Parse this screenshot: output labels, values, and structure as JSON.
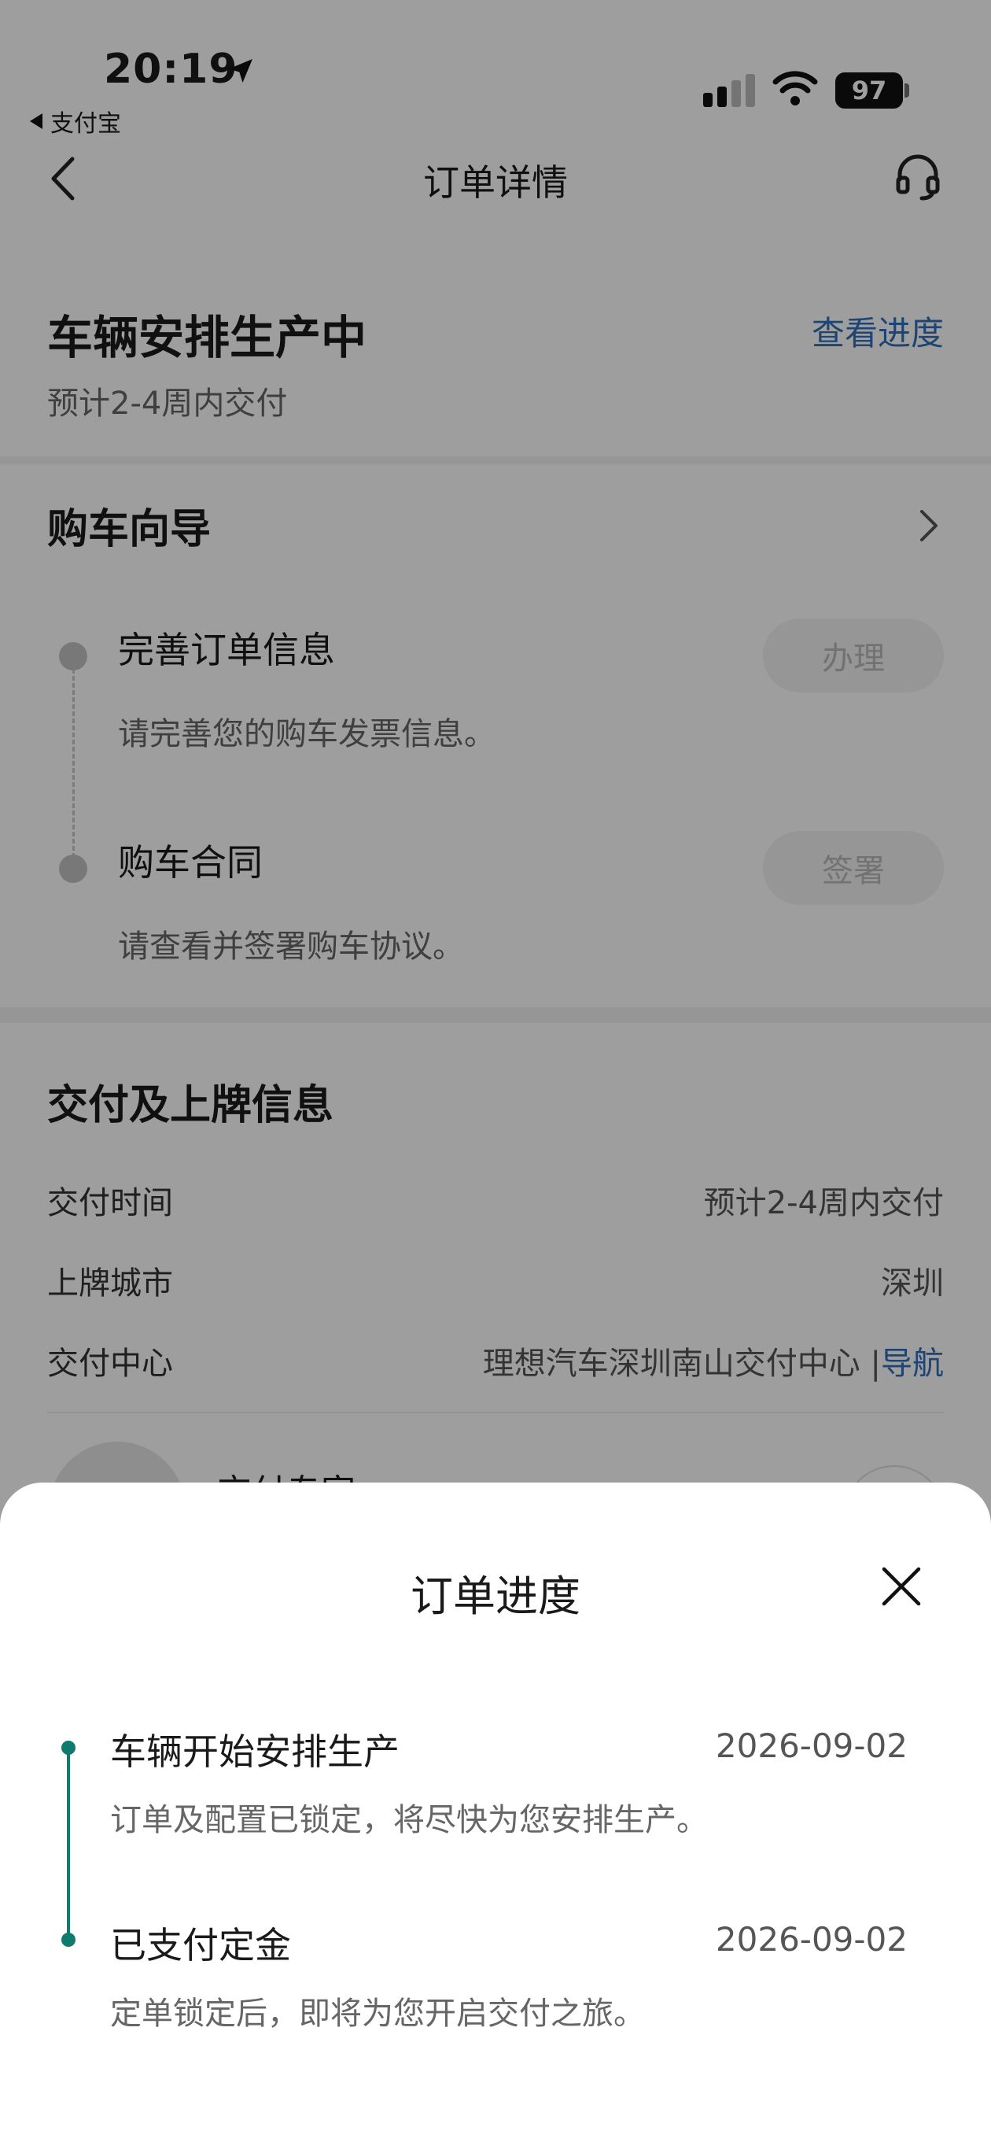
{
  "status_bar": {
    "time": "20:19",
    "back_app": "支付宝",
    "battery": "97",
    "icons": [
      "location-arrow-icon",
      "signal-icon",
      "wifi-icon",
      "battery-icon"
    ]
  },
  "nav": {
    "title": "订单详情",
    "back_icon": "chevron-left-icon",
    "service_icon": "headset-icon"
  },
  "status": {
    "title": "车辆安排生产中",
    "link": "查看进度",
    "subtitle": "预计2-4周内交付"
  },
  "guide": {
    "title": "购车向导",
    "steps": [
      {
        "title": "完善订单信息",
        "desc": "请完善您的购车发票信息。",
        "button": "办理"
      },
      {
        "title": "购车合同",
        "desc": "请查看并签署购车协议。",
        "button": "签署"
      }
    ]
  },
  "delivery": {
    "title": "交付及上牌信息",
    "rows": [
      {
        "label": "交付时间",
        "value": "预计2-4周内交付"
      },
      {
        "label": "上牌城市",
        "value": "深圳"
      },
      {
        "label": "交付中心",
        "value": "理想汽车深圳南山交付中心 |",
        "link": "导航"
      }
    ],
    "expert_label": "交付专家"
  },
  "sheet": {
    "title": "订单进度",
    "close_icon": "close-icon",
    "accent_color": "#0f7a6e",
    "items": [
      {
        "title": "车辆开始安排生产",
        "date": "2026-09-02",
        "desc": "订单及配置已锁定，将尽快为您安排生产。"
      },
      {
        "title": "已支付定金",
        "date": "2026-09-02",
        "desc": "定单锁定后，即将为您开启交付之旅。"
      }
    ]
  }
}
